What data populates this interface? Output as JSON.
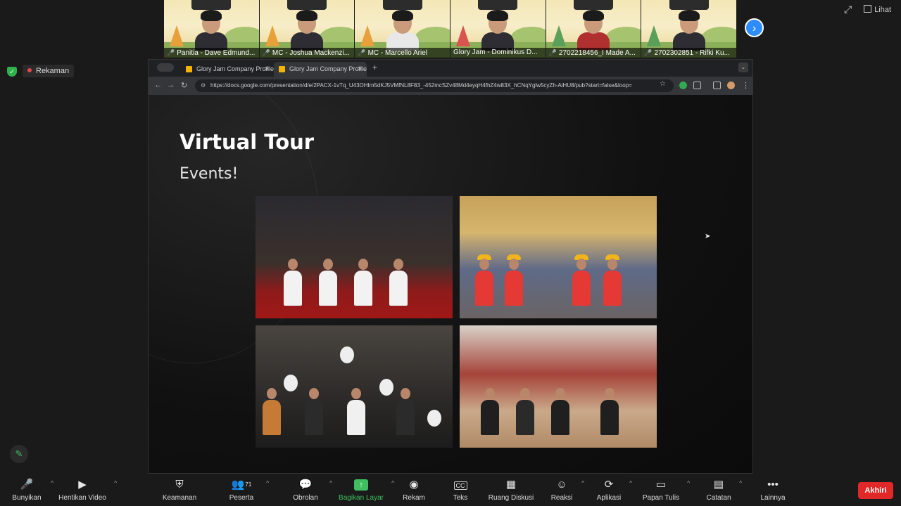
{
  "participants": [
    {
      "name": "Panitia - Dave Edmund..."
    },
    {
      "name": "MC - Joshua Mackenzi..."
    },
    {
      "name": "MC - Marcello Ariel"
    },
    {
      "name": "Glory Jam - Dominikus D..."
    },
    {
      "name": "2702218456_I Made A..."
    },
    {
      "name": "2702302851 - Rifki Ku..."
    }
  ],
  "view_label": "Lihat",
  "recording_label": "Rekaman",
  "browser": {
    "tabs": [
      {
        "title": "Glory Jam Company Profile",
        "active": false
      },
      {
        "title": "Glory Jam Company Profile",
        "active": true
      }
    ],
    "url": "https://docs.google.com/presentation/d/e/2PACX-1vTq_U43OHIm5dKJ5VMfNL8F83_-452mcSZv48Md4eyqH4fhZ4w83X_hCNqYglw5cyZh-AiHU8/pub?start=false&loop="
  },
  "slide": {
    "title": "Virtual Tour",
    "subtitle": "Events!"
  },
  "toolbar": {
    "mute": "Bunyikan",
    "video": "Hentikan Video",
    "security": "Keamanan",
    "participants": "Peserta",
    "participants_count": "71",
    "chat": "Obrolan",
    "share": "Bagikan Layar",
    "record": "Rekam",
    "captions": "Teks",
    "captions_icon": "CC",
    "rooms": "Ruang Diskusi",
    "reactions": "Reaksi",
    "apps": "Aplikasi",
    "whiteboard": "Papan Tulis",
    "notes": "Catatan",
    "more": "Lainnya",
    "end": "Akhiri"
  },
  "colors": {
    "accent": "#2d8cff",
    "share_green": "#3fbf5f",
    "end_red": "#e02828",
    "mic_red": "#e5484d"
  }
}
